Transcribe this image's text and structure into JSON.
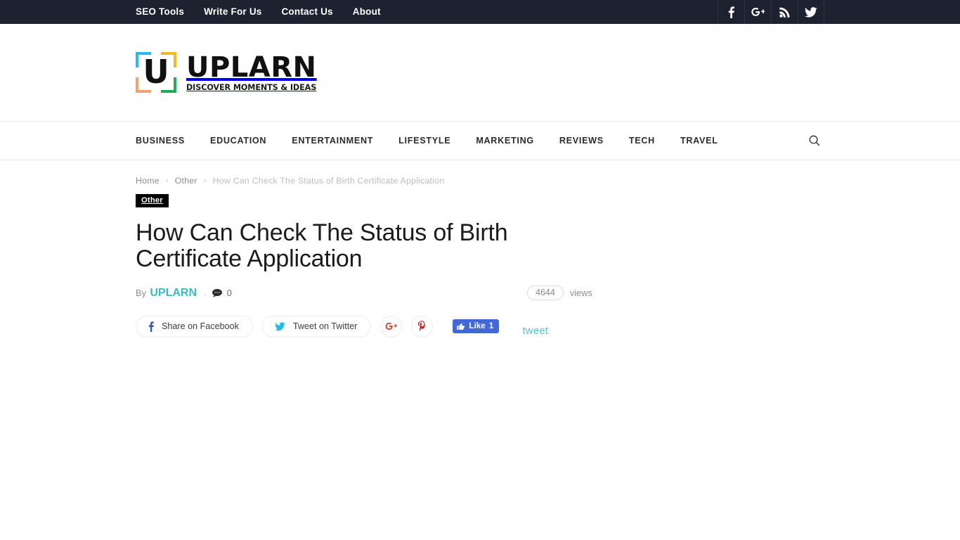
{
  "topbar": {
    "links": [
      {
        "label": "SEO Tools"
      },
      {
        "label": "Write For Us"
      },
      {
        "label": "Contact Us"
      },
      {
        "label": "About"
      }
    ],
    "social": [
      {
        "name": "facebook-icon",
        "label": "Facebook"
      },
      {
        "name": "google-plus-icon",
        "label": "Google Plus"
      },
      {
        "name": "rss-icon",
        "label": "RSS"
      },
      {
        "name": "twitter-icon",
        "label": "Twitter"
      }
    ],
    "background_color": "#1d2130"
  },
  "logo": {
    "mark_letter": "U",
    "wordmark": "UPLARN",
    "tagline": "DISCOVER MOMENTS & IDEAS",
    "corner_colors": {
      "top_left": "#2bb9e8",
      "top_right": "#f5b923",
      "bottom_left": "#f2a172",
      "bottom_right": "#1eac5a"
    }
  },
  "nav": {
    "items": [
      {
        "label": "BUSINESS"
      },
      {
        "label": "EDUCATION"
      },
      {
        "label": "ENTERTAINMENT"
      },
      {
        "label": "LIFESTYLE"
      },
      {
        "label": "MARKETING"
      },
      {
        "label": "REVIEWS"
      },
      {
        "label": "TECH"
      },
      {
        "label": "TRAVEL"
      }
    ],
    "search_icon": "search-icon"
  },
  "breadcrumb": {
    "home": "Home",
    "category": "Other",
    "separator": "›",
    "current": "How Can Check The Status of Birth Certificate Application"
  },
  "post": {
    "category_badge": "Other",
    "title": "How Can Check The Status of Birth Certificate Application",
    "by_prefix": "By",
    "author": "UPLARN",
    "meta_dot": ".",
    "comment_count": "0",
    "views_count": "4644",
    "views_label": "views"
  },
  "share": {
    "facebook_label": "Share on Facebook",
    "twitter_label": "Tweet on Twitter",
    "google_plus_icon": "google-plus-icon",
    "pinterest_icon": "pinterest-icon",
    "fb_like_label": "Like",
    "fb_like_count": "1",
    "tweet_link": "tweet",
    "facebook_color": "#3b5998",
    "twitter_color": "#2bb7ea",
    "google_color": "#d8402f",
    "pinterest_color": "#cb2027",
    "like_button_color": "#4267d7",
    "tweet_link_color": "#5cc0cc"
  }
}
